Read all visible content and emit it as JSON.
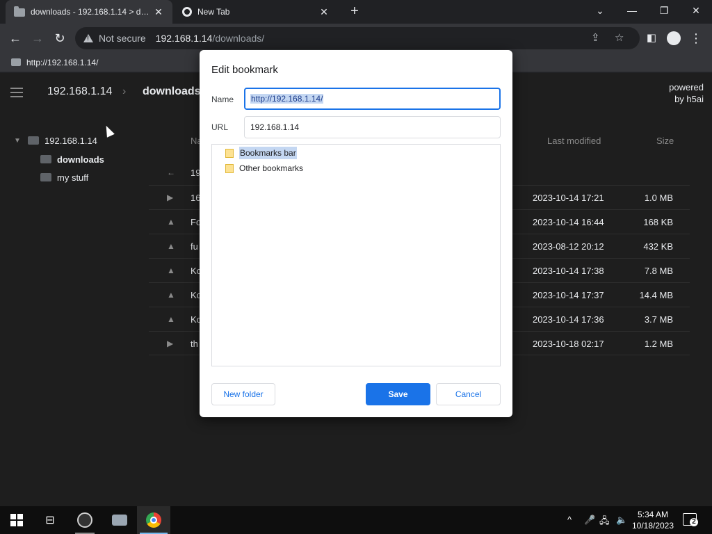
{
  "browser": {
    "tabs": [
      {
        "title": "downloads - 192.168.1.14 > downloads",
        "active": true,
        "favicon": "folder-icon"
      },
      {
        "title": "New Tab",
        "active": false,
        "favicon": "chrome-icon"
      }
    ],
    "close_glyph": "✕",
    "new_tab_glyph": "+",
    "window_controls": {
      "dropdown": "⌄",
      "minimize": "—",
      "restore": "❐",
      "close": "✕"
    },
    "nav": {
      "back": "←",
      "forward": "→",
      "reload": "↻"
    },
    "omnibox": {
      "security_label": "Not secure",
      "host": "192.168.1.14",
      "path": "/downloads/"
    },
    "bookmarks_bar": [
      {
        "label": "http://192.168.1.14/"
      }
    ]
  },
  "h5ai": {
    "breadcrumb": {
      "host": "192.168.1.14",
      "separator": "›",
      "current": "downloads"
    },
    "powered_line1": "powered",
    "powered_line2": "by h5ai",
    "tree": {
      "root": "192.168.1.14",
      "items": [
        {
          "label": "downloads",
          "bold": true
        },
        {
          "label": "my stuff",
          "bold": false
        }
      ]
    },
    "columns": {
      "name": "Na",
      "modified": "Last modified",
      "size": "Size"
    },
    "files": [
      {
        "icon": "←",
        "name": "19",
        "date": "",
        "size": ""
      },
      {
        "icon": "▶",
        "name": "16",
        "date": "2023-10-14 17:21",
        "size": "1.0 MB"
      },
      {
        "icon": "▲",
        "name": "Fo",
        "date": "2023-10-14 16:44",
        "size": "168 KB"
      },
      {
        "icon": "▲",
        "name": "fu",
        "date": "2023-08-12 20:12",
        "size": "432 KB"
      },
      {
        "icon": "▲",
        "name": "Ko",
        "date": "2023-10-14 17:38",
        "size": "7.8 MB"
      },
      {
        "icon": "▲",
        "name": "Ko",
        "date": "2023-10-14 17:37",
        "size": "14.4 MB"
      },
      {
        "icon": "▲",
        "name": "Ko",
        "date": "2023-10-14 17:36",
        "size": "3.7 MB"
      },
      {
        "icon": "▶",
        "name": "th",
        "date": "2023-10-18 02:17",
        "size": "1.2 MB"
      }
    ]
  },
  "dialog": {
    "title": "Edit bookmark",
    "name_label": "Name",
    "name_value": "http://192.168.1.14/",
    "url_label": "URL",
    "url_value": "192.168.1.14",
    "folders": [
      {
        "label": "Bookmarks bar",
        "selected": true
      },
      {
        "label": "Other bookmarks",
        "selected": false
      }
    ],
    "new_folder": "New folder",
    "save": "Save",
    "cancel": "Cancel"
  },
  "taskbar": {
    "time": "5:34 AM",
    "date": "10/18/2023",
    "notification_count": "2",
    "tray_chevron": "^"
  },
  "colors": {
    "accent": "#1a73e8",
    "page_bg": "#1e1e1e",
    "chrome_dark": "#35363a"
  }
}
